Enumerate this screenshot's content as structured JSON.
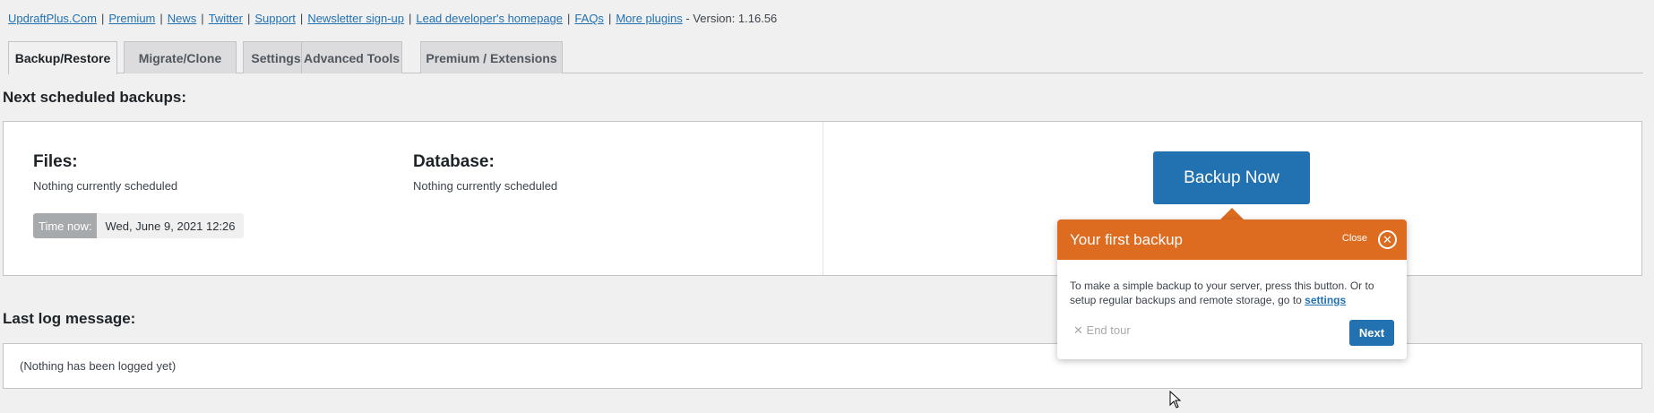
{
  "top_links": {
    "links": [
      "UpdraftPlus.Com",
      "Premium",
      "News",
      "Twitter",
      "Support",
      "Newsletter sign-up",
      "Lead developer's homepage",
      "FAQs",
      "More plugins"
    ],
    "version_text": "- Version: 1.16.56"
  },
  "tabs": [
    {
      "label": "Backup/Restore",
      "active": true
    },
    {
      "label": "Migrate/Clone",
      "active": false
    },
    {
      "label": "Settings",
      "active": false
    },
    {
      "label": "Advanced Tools",
      "active": false
    },
    {
      "label": "Premium / Extensions",
      "active": false
    }
  ],
  "scheduled": {
    "title": "Next scheduled backups:",
    "files": {
      "heading": "Files:",
      "status": "Nothing currently scheduled"
    },
    "database": {
      "heading": "Database:",
      "status": "Nothing currently scheduled"
    },
    "time_now_label": "Time now:",
    "time_now_value": "Wed, June 9, 2021 12:26",
    "backup_button": "Backup Now"
  },
  "log": {
    "title": "Last log message:",
    "message": "(Nothing has been logged yet)"
  },
  "tour": {
    "title": "Your first backup",
    "close_label": "Close",
    "body_text": "To make a simple backup to your server, press this button. Or to setup regular backups and remote storage, go to",
    "settings_link": "settings",
    "end_tour": "End tour",
    "next_button": "Next"
  },
  "colors": {
    "accent": "#2271b1",
    "tour_header": "#dd6b20",
    "background": "#f0f0f1"
  }
}
